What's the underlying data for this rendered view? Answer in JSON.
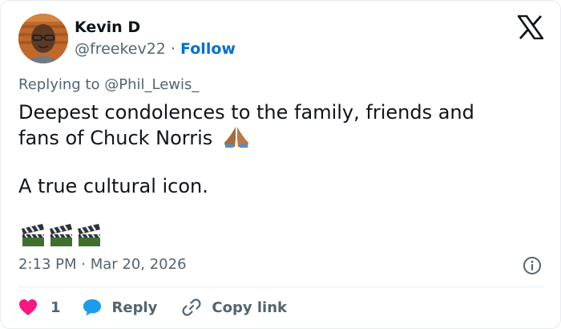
{
  "author": {
    "name": "Kevin D",
    "handle": "@freekev22",
    "separator": "·",
    "follow_label": "Follow"
  },
  "reply_context": {
    "prefix": "Replying to",
    "mention": "@Phil_Lewis_"
  },
  "tweet": {
    "line1": "Deepest condolences to the family, friends and",
    "line2": "fans of Chuck Norris",
    "line3": "A true cultural icon.",
    "inline_emoji": "folded-hands-emoji",
    "emoji_row": [
      "clapper-board-emoji",
      "clapper-board-emoji",
      "clapper-board-emoji"
    ]
  },
  "meta": {
    "timestamp": "2:13 PM · Mar 20, 2026"
  },
  "actions": {
    "like_count": "1",
    "reply_label": "Reply",
    "copy_label": "Copy link"
  },
  "colors": {
    "follow": "#006fd6",
    "like_heart": "#f91880",
    "reply_bubble": "#1d9bf0",
    "secondary_text": "#536471",
    "primary_text": "#0f1419"
  }
}
